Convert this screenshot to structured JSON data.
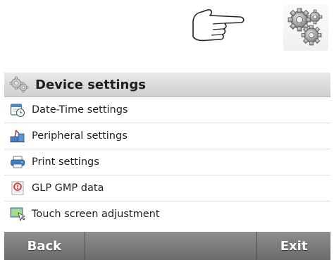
{
  "top": {
    "touch_icon": "pointing-hand-icon",
    "settings_icon": "gears-icon"
  },
  "header": {
    "icon": "gears-icon",
    "title": "Device settings"
  },
  "items": [
    {
      "label": "Date-Time settings",
      "icon": "calendar-clock-icon"
    },
    {
      "label": "Peripheral settings",
      "icon": "peripheral-devices-icon"
    },
    {
      "label": "Print settings",
      "icon": "printer-icon"
    },
    {
      "label": "GLP GMP data",
      "icon": "glp-data-icon"
    },
    {
      "label": "Touch screen adjustment",
      "icon": "touch-screen-icon"
    }
  ],
  "footer": {
    "back_label": "Back",
    "middle_label": "",
    "exit_label": "Exit"
  },
  "colors": {
    "header_bg": "#d9d9d9",
    "footer_bg": "#7c7c7c",
    "footer_text": "#ffffff"
  }
}
